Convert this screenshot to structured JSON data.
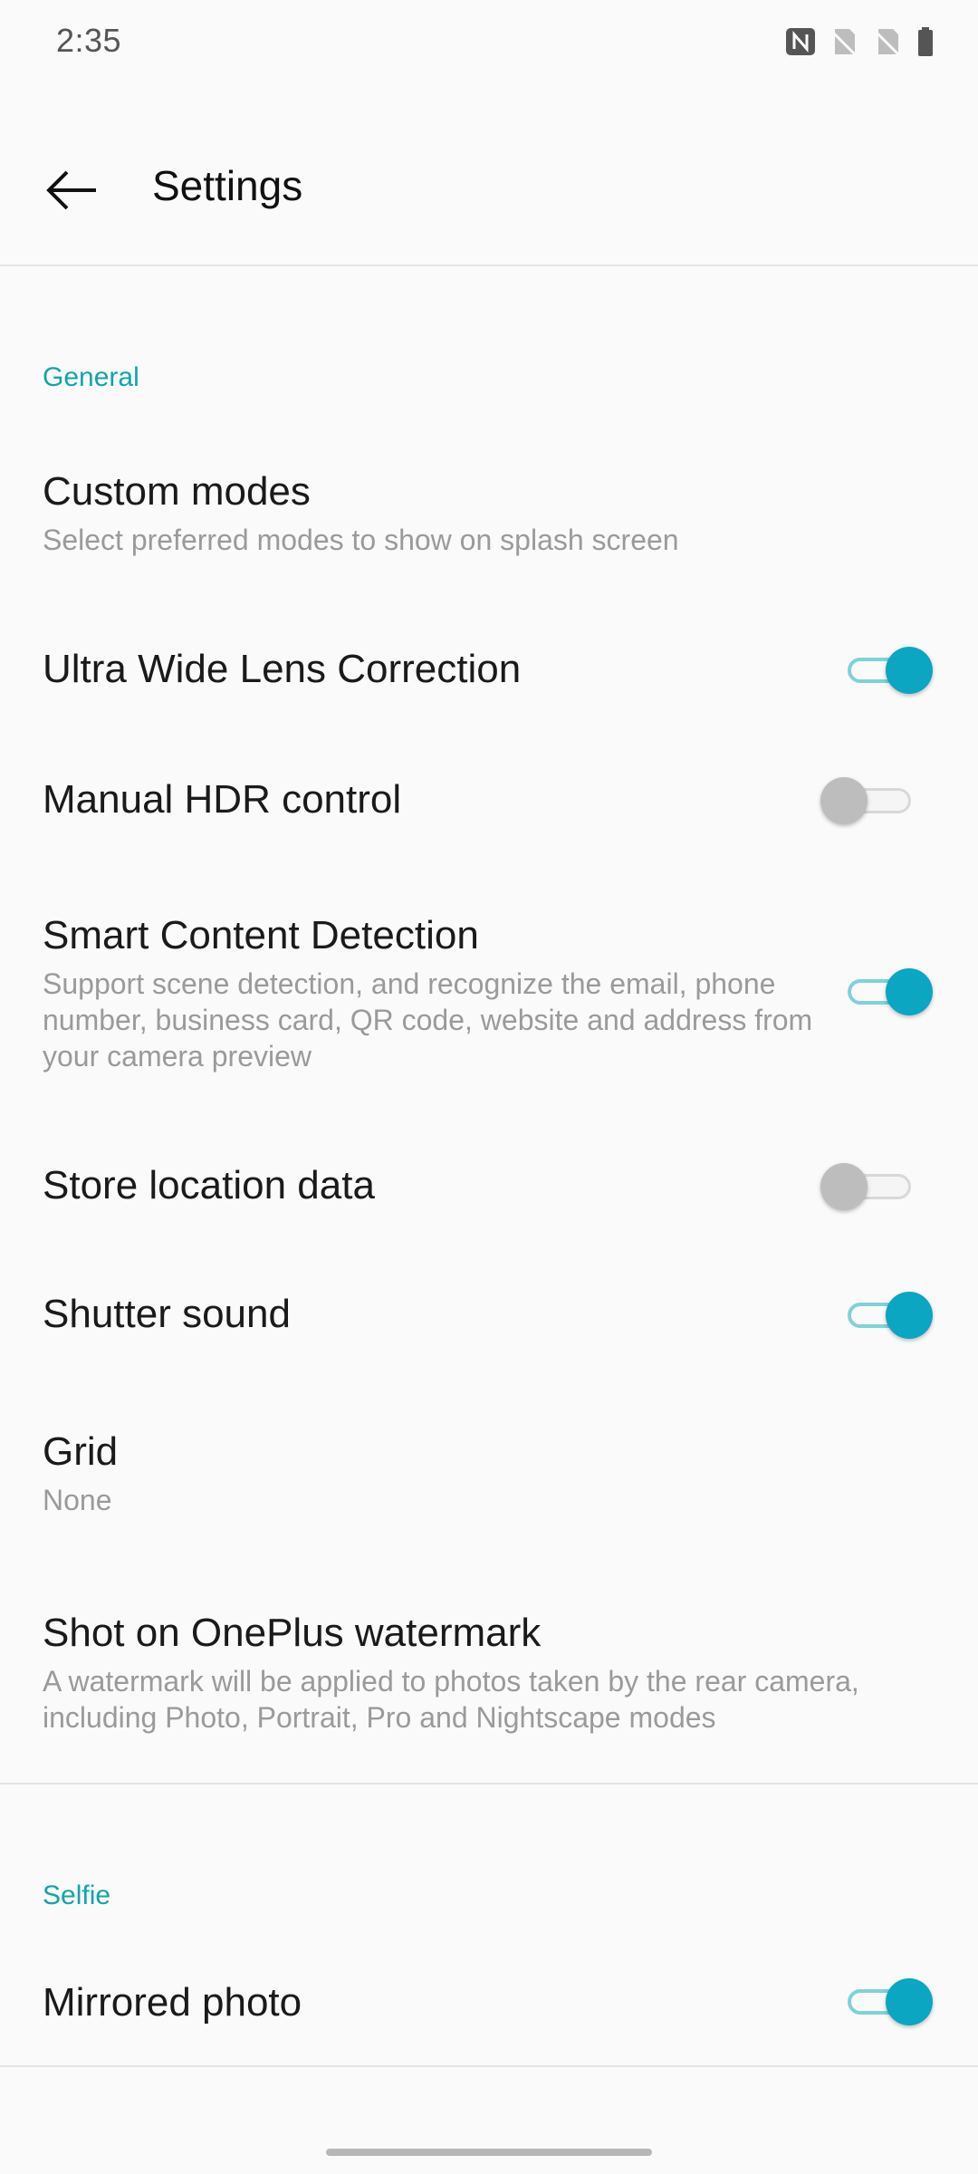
{
  "status_bar": {
    "time": "2:35",
    "icons": [
      "nfc-icon",
      "no-sim-icon",
      "no-sim-icon",
      "battery-icon"
    ]
  },
  "app_bar": {
    "back_icon": "arrow-left-icon",
    "title": "Settings"
  },
  "colors": {
    "accent": "#12a4ac",
    "toggle_on": "#0aa6c2",
    "toggle_off": "#bdbdbd",
    "background": "#fafafa"
  },
  "sections": {
    "general": {
      "header": "General",
      "items": [
        {
          "title": "Custom modes",
          "subtitle": "Select preferred modes to show on splash screen"
        },
        {
          "title": "Ultra Wide Lens Correction",
          "toggle": true
        },
        {
          "title": "Manual HDR control",
          "toggle": false
        },
        {
          "title": "Smart Content Detection",
          "subtitle": "Support scene detection, and recognize the email, phone number, business card, QR code, website and address from your camera preview",
          "toggle": true
        },
        {
          "title": "Store location data",
          "toggle": false
        },
        {
          "title": "Shutter sound",
          "toggle": true
        },
        {
          "title": "Grid",
          "subtitle": "None"
        },
        {
          "title": "Shot on OnePlus watermark",
          "subtitle": "A watermark will be applied to photos taken by the rear camera, including Photo, Portrait, Pro and Nightscape modes"
        }
      ]
    },
    "selfie": {
      "header": "Selfie",
      "items": [
        {
          "title": "Mirrored photo",
          "toggle": true
        }
      ]
    }
  }
}
